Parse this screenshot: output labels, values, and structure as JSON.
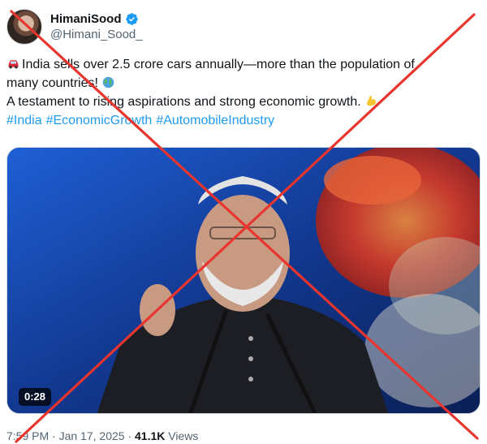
{
  "author": {
    "display_name": "HimaniSood",
    "handle": "@Himani_Sood_",
    "verified": true
  },
  "tweet": {
    "line1": "India sells over 2.5 crore cars annually—more than the population of",
    "line2": "many countries!",
    "line3": "A testament to rising aspirations and strong economic growth.",
    "hashtags": [
      "#India",
      "#EconomicGrowth",
      "#AutomobileIndustry"
    ],
    "emojis": [
      "car-emoji",
      "globe-emoji",
      "flexed-biceps-emoji"
    ]
  },
  "media": {
    "type": "video",
    "duration": "0:28"
  },
  "meta": {
    "time": "7:59 PM",
    "separator": "·",
    "date": "Jan 17, 2025",
    "views_count": "41.1K",
    "views_label": "Views"
  },
  "colors": {
    "link": "#1d9bf0",
    "secondary_text": "#536471",
    "cross_overlay": "#e8352e"
  },
  "icons": [
    "verified-badge-icon",
    "more-options-icon",
    "cross-overlay"
  ]
}
